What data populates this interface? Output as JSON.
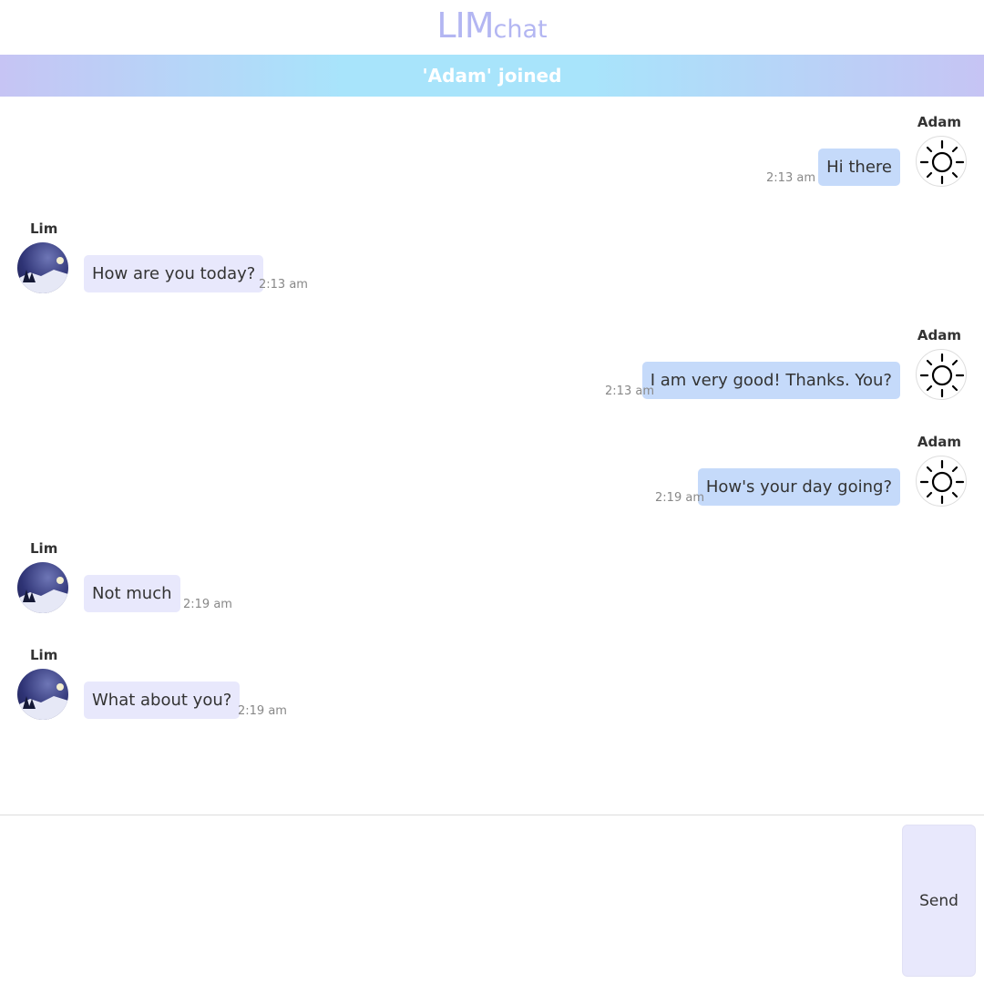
{
  "app": {
    "logo_big": "LIM",
    "logo_small": "chat"
  },
  "banner": {
    "text": "'Adam' joined"
  },
  "messages": [
    {
      "sender": "Adam",
      "text": "Hi there",
      "time": "2:13 am",
      "avatar_icon": "sun-icon"
    },
    {
      "sender": "Lim",
      "text": "How are you today?",
      "time": "2:13 am",
      "avatar_icon": "night-landscape-avatar"
    },
    {
      "sender": "Adam",
      "text": "I am very good! Thanks. You?",
      "time": "2:13 am",
      "avatar_icon": "sun-icon"
    },
    {
      "sender": "Adam",
      "text": "How's your day going?",
      "time": "2:19 am",
      "avatar_icon": "sun-icon"
    },
    {
      "sender": "Lim",
      "text": "Not much",
      "time": "2:19 am",
      "avatar_icon": "night-landscape-avatar"
    },
    {
      "sender": "Lim",
      "text": "What about you?",
      "time": "2:19 am",
      "avatar_icon": "night-landscape-avatar"
    }
  ],
  "composer": {
    "placeholder": "",
    "send_label": "Send"
  },
  "colors": {
    "accent": "#b3b6f2",
    "mine_bubble": "#c5dafa",
    "their_bubble": "#e8e8fc",
    "banner_start": "#c6c4f4",
    "banner_mid": "#a8e4fb"
  }
}
